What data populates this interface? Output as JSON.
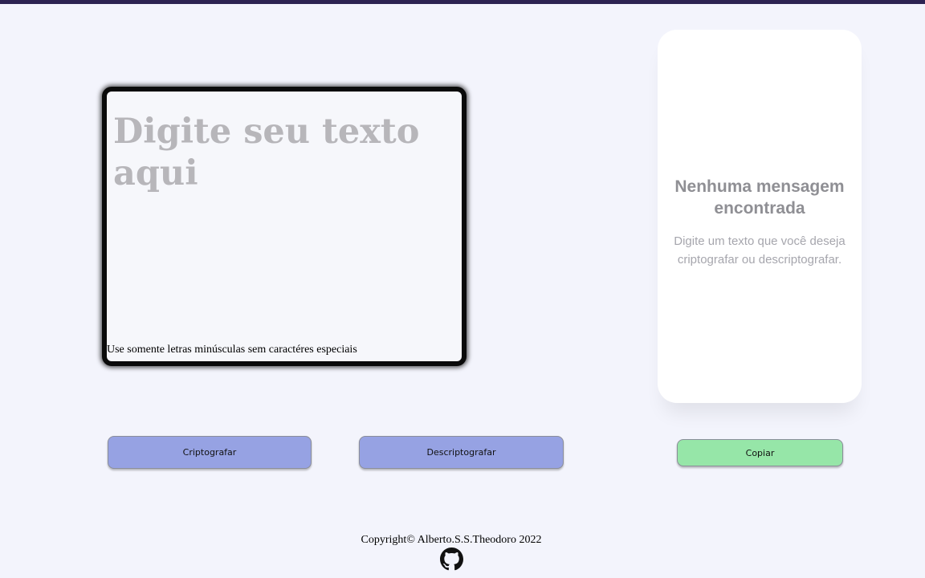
{
  "input": {
    "placeholder": "Digite seu texto aqui",
    "hint": "Use somente letras minúsculas sem caractéres especiais"
  },
  "output": {
    "title": "Nenhuma mensagem encontrada",
    "subtitle": "Digite um texto que você deseja criptografar ou descriptografar."
  },
  "buttons": {
    "encrypt": "Criptografar",
    "decrypt": "Descriptografar",
    "copy": "Copiar"
  },
  "footer": {
    "copyright": "Copyright© Alberto.S.S.Theodoro 2022",
    "github_icon": "github-icon"
  },
  "colors": {
    "background": "#f3f4fc",
    "top_bar": "#2d2352",
    "primary_button": "#96a2e3",
    "copy_button": "#96e6a8"
  }
}
